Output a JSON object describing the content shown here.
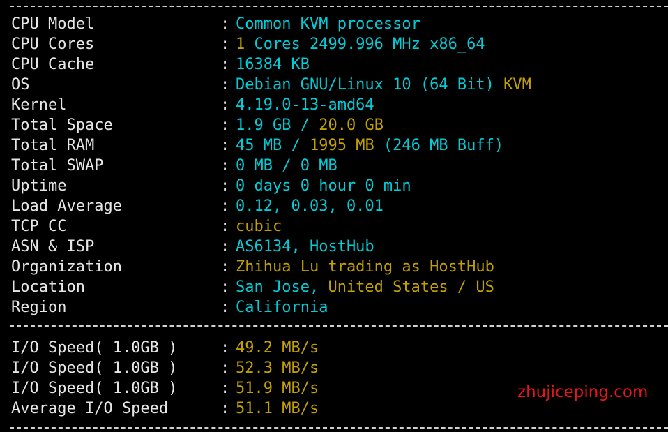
{
  "terminal": {
    "background_color": "#000000",
    "label_color": "#e6e6e6",
    "cyan_color": "#00cdd7",
    "yellow_color": "#c2a000",
    "watermark_color": "#e8141b",
    "separator_char": "-",
    "colon": ":"
  },
  "separators": {
    "top": "------------------------------------------------------------------------",
    "middle": "------------------------------------------------------------------------",
    "bottom": "------------------------------------------------------------------------"
  },
  "system_info": {
    "rows": [
      {
        "label": "CPU Model",
        "value": "Common KVM processor",
        "parts": [
          {
            "text": "Common KVM processor",
            "color": "cyan"
          }
        ]
      },
      {
        "label": "CPU Cores",
        "value": "1 Cores 2499.996 MHz x86_64",
        "parts": [
          {
            "text": "1",
            "color": "yellow"
          },
          {
            "text": " Cores 2499.996 MHz x86_64",
            "color": "cyan"
          }
        ]
      },
      {
        "label": "CPU Cache",
        "value": "16384 KB",
        "parts": [
          {
            "text": "16384 KB",
            "color": "cyan"
          }
        ]
      },
      {
        "label": "OS",
        "value": "Debian GNU/Linux 10 (64 Bit) KVM",
        "parts": [
          {
            "text": "Debian GNU/Linux 10 (64 Bit) ",
            "color": "cyan"
          },
          {
            "text": "KVM",
            "color": "yellow"
          }
        ]
      },
      {
        "label": "Kernel",
        "value": "4.19.0-13-amd64",
        "parts": [
          {
            "text": "4.19.0-13-amd64",
            "color": "cyan"
          }
        ]
      },
      {
        "label": "Total Space",
        "value": "1.9 GB / 20.0 GB",
        "parts": [
          {
            "text": "1.9 GB / ",
            "color": "cyan"
          },
          {
            "text": "20.0 GB",
            "color": "yellow"
          }
        ]
      },
      {
        "label": "Total RAM",
        "value": "45 MB / 1995 MB (246 MB Buff)",
        "parts": [
          {
            "text": "45 MB / ",
            "color": "cyan"
          },
          {
            "text": "1995 MB",
            "color": "yellow"
          },
          {
            "text": " (246 MB Buff)",
            "color": "cyan"
          }
        ]
      },
      {
        "label": "Total SWAP",
        "value": "0 MB / 0 MB",
        "parts": [
          {
            "text": "0 MB / 0 MB",
            "color": "cyan"
          }
        ]
      },
      {
        "label": "Uptime",
        "value": "0 days 0 hour 0 min",
        "parts": [
          {
            "text": "0 days 0 hour 0 min",
            "color": "cyan"
          }
        ]
      },
      {
        "label": "Load Average",
        "value": "0.12, 0.03, 0.01",
        "parts": [
          {
            "text": "0.12, 0.03, 0.01",
            "color": "cyan"
          }
        ]
      },
      {
        "label": "TCP CC",
        "value": "cubic",
        "parts": [
          {
            "text": "cubic",
            "color": "yellow"
          }
        ]
      },
      {
        "label": "ASN & ISP",
        "value": "AS6134, HostHub",
        "parts": [
          {
            "text": "AS6134, HostHub",
            "color": "cyan"
          }
        ]
      },
      {
        "label": "Organization",
        "value": "Zhihua Lu trading as HostHub",
        "parts": [
          {
            "text": "Zhihua Lu trading as HostHub",
            "color": "yellow"
          }
        ]
      },
      {
        "label": "Location",
        "value": "San Jose, United States / US",
        "parts": [
          {
            "text": "San Jose, ",
            "color": "cyan"
          },
          {
            "text": "United States / US",
            "color": "yellow"
          }
        ]
      },
      {
        "label": "Region",
        "value": "California",
        "parts": [
          {
            "text": "California",
            "color": "cyan"
          }
        ]
      }
    ]
  },
  "io_results": {
    "rows": [
      {
        "label": "I/O Speed( 1.0GB )",
        "value": "49.2 MB/s",
        "parts": [
          {
            "text": "49.2 MB/s",
            "color": "yellow"
          }
        ]
      },
      {
        "label": "I/O Speed( 1.0GB )",
        "value": "52.3 MB/s",
        "parts": [
          {
            "text": "52.3 MB/s",
            "color": "yellow"
          }
        ]
      },
      {
        "label": "I/O Speed( 1.0GB )",
        "value": "51.9 MB/s",
        "parts": [
          {
            "text": "51.9 MB/s",
            "color": "yellow"
          }
        ]
      },
      {
        "label": "Average I/O Speed",
        "value": "51.1 MB/s",
        "parts": [
          {
            "text": "51.1 MB/s",
            "color": "yellow"
          }
        ]
      }
    ]
  },
  "watermark": {
    "text": "zhujiceping.com"
  }
}
